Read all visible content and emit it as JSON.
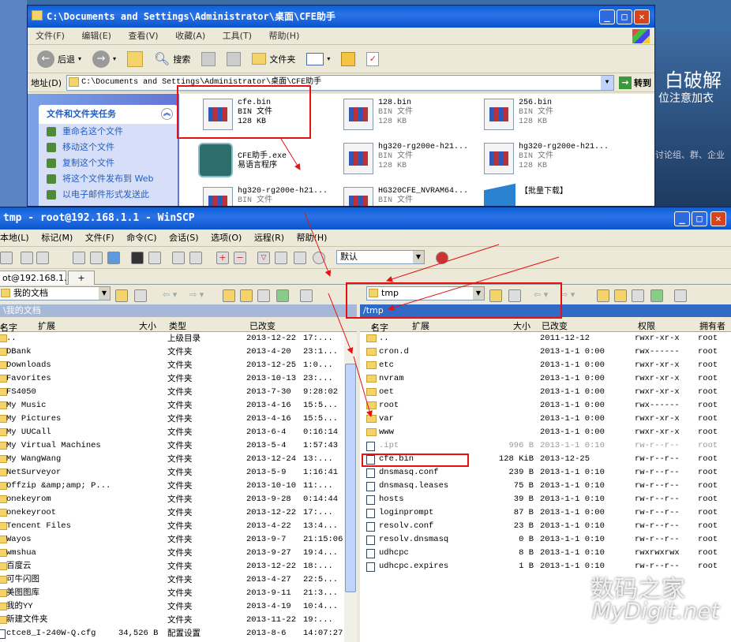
{
  "desktop": {
    "left_text": "",
    "right_lines": [
      "白破解",
      "位注意加衣",
      "讨论组、群、企业"
    ]
  },
  "explorer": {
    "title": "C:\\Documents and Settings\\Administrator\\桌面\\CFE助手",
    "menu": [
      "文件(F)",
      "编辑(E)",
      "查看(V)",
      "收藏(A)",
      "工具(T)",
      "帮助(H)"
    ],
    "toolbar": {
      "back": "后退",
      "search": "搜索",
      "folders": "文件夹"
    },
    "address_label": "地址(D)",
    "address": "C:\\Documents and Settings\\Administrator\\桌面\\CFE助手",
    "go": "转到",
    "tasks": {
      "header": "文件和文件夹任务",
      "items": [
        "重命名这个文件",
        "移动这个文件",
        "复制这个文件",
        "将这个文件发布到 Web",
        "以电子邮件形式发送此"
      ]
    },
    "files": [
      {
        "name": "cfe.bin",
        "type": "BIN 文件",
        "size": "128 KB"
      },
      {
        "name": "128.bin",
        "type": "BIN 文件",
        "size": "128 KB"
      },
      {
        "name": "256.bin",
        "type": "BIN 文件",
        "size": "128 KB"
      },
      {
        "name": "CFE助手.exe",
        "type": "易语言程序",
        "size": ""
      },
      {
        "name": "hg320-rg200e-h21...",
        "type": "BIN 文件",
        "size": "128 KB"
      },
      {
        "name": "hg320-rg200e-h21...",
        "type": "BIN 文件",
        "size": "128 KB"
      },
      {
        "name": "hg320-rg200e-h21...",
        "type": "BIN 文件",
        "size": ""
      },
      {
        "name": "HG320CFE_NVRAM64...",
        "type": "BIN 文件",
        "size": ""
      },
      {
        "name": "【批量下载】",
        "type": "",
        "size": ""
      }
    ]
  },
  "winscp": {
    "title": "tmp - root@192.168.1.1 - WinSCP",
    "menu": [
      "本地(L)",
      "标记(M)",
      "文件(F)",
      "命令(C)",
      "会话(S)",
      "选项(O)",
      "远程(R)",
      "帮助(H)"
    ],
    "toolbar_combo": "默认",
    "session_tab": "ot@192.168.1.1",
    "new_tab": "+",
    "left": {
      "combo": "我的文档",
      "path": "\\我的文档",
      "columns": [
        "名字",
        "扩展",
        "大小",
        "类型",
        "已改变"
      ],
      "rows": [
        {
          "name": "..",
          "size": "",
          "type": "上级目录",
          "date": "2013-12-22",
          "time": "17:..."
        },
        {
          "name": "DBank",
          "size": "",
          "type": "文件夹",
          "date": "2013-4-20",
          "time": "23:1..."
        },
        {
          "name": "Downloads",
          "size": "",
          "type": "文件夹",
          "date": "2013-12-25",
          "time": "1:0..."
        },
        {
          "name": "Favorites",
          "size": "",
          "type": "文件夹",
          "date": "2013-10-13",
          "time": "23:..."
        },
        {
          "name": "FS4050",
          "size": "",
          "type": "文件夹",
          "date": "2013-7-30",
          "time": "9:28:02"
        },
        {
          "name": "My Music",
          "size": "",
          "type": "文件夹",
          "date": "2013-4-16",
          "time": "15:5..."
        },
        {
          "name": "My Pictures",
          "size": "",
          "type": "文件夹",
          "date": "2013-4-16",
          "time": "15:5..."
        },
        {
          "name": "My UUCall",
          "size": "",
          "type": "文件夹",
          "date": "2013-6-4",
          "time": "0:16:14"
        },
        {
          "name": "My Virtual Machines",
          "size": "",
          "type": "文件夹",
          "date": "2013-5-4",
          "time": "1:57:43"
        },
        {
          "name": "My WangWang",
          "size": "",
          "type": "文件夹",
          "date": "2013-12-24",
          "time": "13:..."
        },
        {
          "name": "NetSurveyor",
          "size": "",
          "type": "文件夹",
          "date": "2013-5-9",
          "time": "1:16:41"
        },
        {
          "name": "Offzip &amp;amp; P...",
          "size": "",
          "type": "文件夹",
          "date": "2013-10-10",
          "time": "11:..."
        },
        {
          "name": "onekeyrom",
          "size": "",
          "type": "文件夹",
          "date": "2013-9-28",
          "time": "0:14:44"
        },
        {
          "name": "onekeyroot",
          "size": "",
          "type": "文件夹",
          "date": "2013-12-22",
          "time": "17:..."
        },
        {
          "name": "Tencent Files",
          "size": "",
          "type": "文件夹",
          "date": "2013-4-22",
          "time": "13:4..."
        },
        {
          "name": "Wayos",
          "size": "",
          "type": "文件夹",
          "date": "2013-9-7",
          "time": "21:15:06"
        },
        {
          "name": "wmshua",
          "size": "",
          "type": "文件夹",
          "date": "2013-9-27",
          "time": "19:4..."
        },
        {
          "name": "百度云",
          "size": "",
          "type": "文件夹",
          "date": "2013-12-22",
          "time": "18:..."
        },
        {
          "name": "可牛闪图",
          "size": "",
          "type": "文件夹",
          "date": "2013-4-27",
          "time": "22:5..."
        },
        {
          "name": "美图图库",
          "size": "",
          "type": "文件夹",
          "date": "2013-9-11",
          "time": "21:3..."
        },
        {
          "name": "我的YY",
          "size": "",
          "type": "文件夹",
          "date": "2013-4-19",
          "time": "10:4..."
        },
        {
          "name": "新建文件夹",
          "size": "",
          "type": "文件夹",
          "date": "2013-11-22",
          "time": "19:..."
        },
        {
          "name": "ctce8_I-240W-Q.cfg",
          "size": "34,526 B",
          "type": "配置设置",
          "date": "2013-8-6",
          "time": "14:07:27"
        }
      ]
    },
    "right": {
      "combo": "tmp",
      "path": "/tmp",
      "columns": [
        "名字",
        "扩展",
        "大小",
        "已改变",
        "权限",
        "拥有者"
      ],
      "rows": [
        {
          "name": "..",
          "kind": "up",
          "size": "",
          "date": "2011-12-12",
          "perm": "rwxr-xr-x",
          "owner": "root"
        },
        {
          "name": "cron.d",
          "kind": "dir",
          "size": "",
          "date": "2013-1-1 0:00",
          "perm": "rwx------",
          "owner": "root"
        },
        {
          "name": "etc",
          "kind": "dir",
          "size": "",
          "date": "2013-1-1 0:00",
          "perm": "rwxr-xr-x",
          "owner": "root"
        },
        {
          "name": "nvram",
          "kind": "dir",
          "size": "",
          "date": "2013-1-1 0:00",
          "perm": "rwxr-xr-x",
          "owner": "root"
        },
        {
          "name": "oet",
          "kind": "dir",
          "size": "",
          "date": "2013-1-1 0:00",
          "perm": "rwxr-xr-x",
          "owner": "root"
        },
        {
          "name": "root",
          "kind": "dir",
          "size": "",
          "date": "2013-1-1 0:00",
          "perm": "rwx------",
          "owner": "root"
        },
        {
          "name": "var",
          "kind": "dir",
          "size": "",
          "date": "2013-1-1 0:00",
          "perm": "rwxr-xr-x",
          "owner": "root"
        },
        {
          "name": "www",
          "kind": "dir",
          "size": "",
          "date": "2013-1-1 0:00",
          "perm": "rwxr-xr-x",
          "owner": "root"
        },
        {
          "name": ".ipt",
          "kind": "dim",
          "size": "996 B",
          "date": "2013-1-1 0:10",
          "perm": "rw-r--r--",
          "owner": "root"
        },
        {
          "name": "cfe.bin",
          "kind": "file",
          "size": "128 KiB",
          "date": "2013-12-25",
          "perm": "rw-r--r--",
          "owner": "root"
        },
        {
          "name": "dnsmasq.conf",
          "kind": "file",
          "size": "239 B",
          "date": "2013-1-1 0:10",
          "perm": "rw-r--r--",
          "owner": "root"
        },
        {
          "name": "dnsmasq.leases",
          "kind": "file",
          "size": "75 B",
          "date": "2013-1-1 0:10",
          "perm": "rw-r--r--",
          "owner": "root"
        },
        {
          "name": "hosts",
          "kind": "file",
          "size": "39 B",
          "date": "2013-1-1 0:10",
          "perm": "rw-r--r--",
          "owner": "root"
        },
        {
          "name": "loginprompt",
          "kind": "file",
          "size": "87 B",
          "date": "2013-1-1 0:00",
          "perm": "rw-r--r--",
          "owner": "root"
        },
        {
          "name": "resolv.conf",
          "kind": "file",
          "size": "23 B",
          "date": "2013-1-1 0:10",
          "perm": "rw-r--r--",
          "owner": "root"
        },
        {
          "name": "resolv.dnsmasq",
          "kind": "file",
          "size": "0 B",
          "date": "2013-1-1 0:10",
          "perm": "rw-r--r--",
          "owner": "root"
        },
        {
          "name": "udhcpc",
          "kind": "file",
          "size": "8 B",
          "date": "2013-1-1 0:10",
          "perm": "rwxrwxrwx",
          "owner": "root"
        },
        {
          "name": "udhcpc.expires",
          "kind": "file",
          "size": "1 B",
          "date": "2013-1-1 0:10",
          "perm": "rw-r--r--",
          "owner": "root"
        }
      ]
    }
  },
  "watermark": {
    "line1": "数码之家",
    "line2": "MyDigit.net"
  },
  "colors": {
    "titlebar": "#0a5fd8",
    "highlight_red": "#e81010",
    "path_bar": "#316ac5"
  }
}
